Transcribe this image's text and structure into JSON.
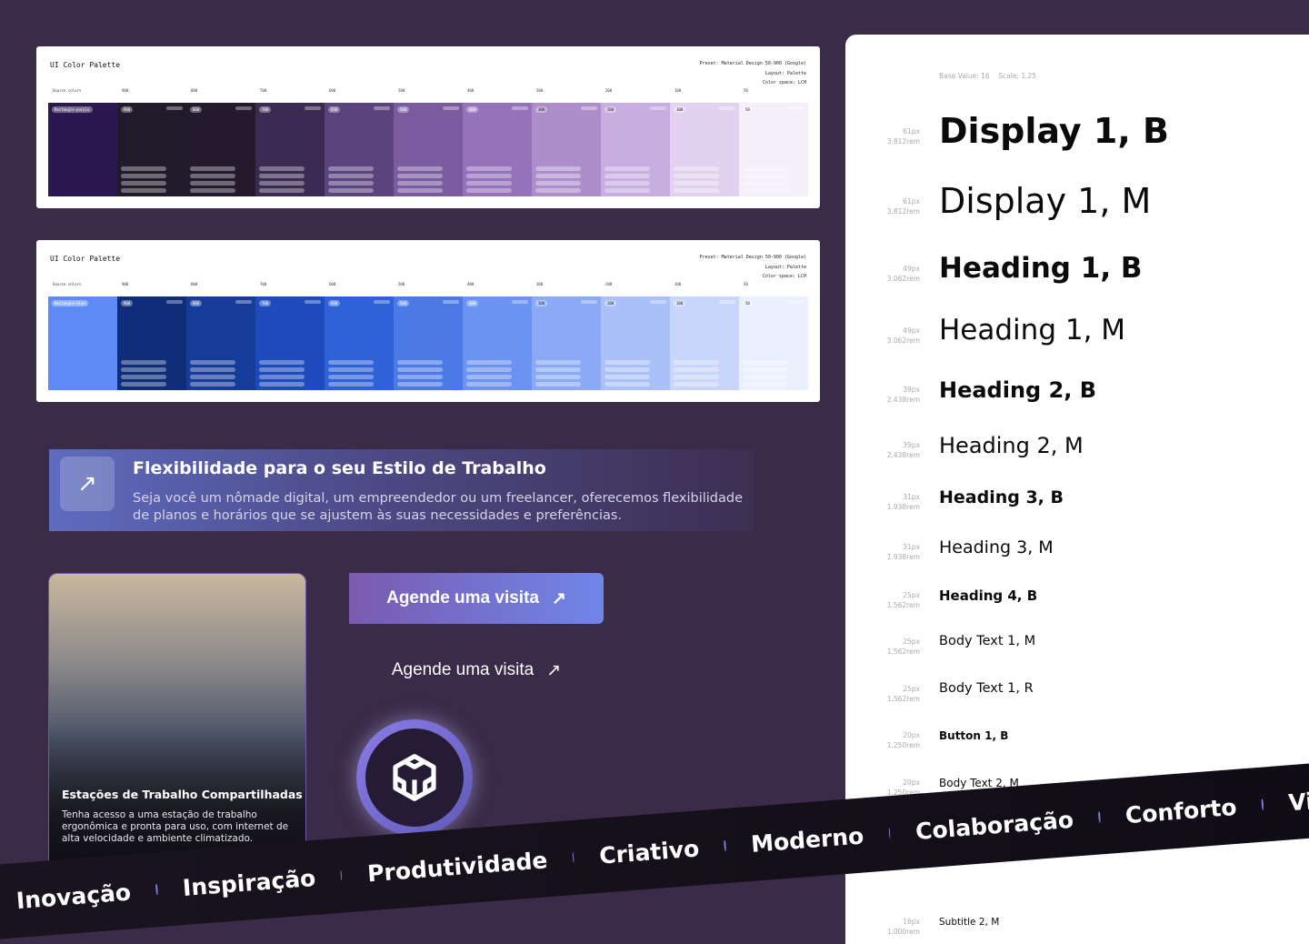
{
  "palettes": [
    {
      "title": "UI Color Palette",
      "preset": "Preset: Material Design 50-900 (Google)",
      "layout": "Layout: Palette",
      "colorspace": "Color space: LCH",
      "source_label": "Source colors",
      "source_name": "Rectangle-purple",
      "steps": [
        "900",
        "800",
        "700",
        "600",
        "500",
        "400",
        "300",
        "200",
        "100",
        "50"
      ],
      "colors": [
        "#2c1850",
        "#211a2a",
        "#231a2e",
        "#3b2a52",
        "#5b437e",
        "#7a5b9f",
        "#9672bb",
        "#ad8ecb",
        "#c8aee0",
        "#e2d2f0",
        "#f5eff9"
      ]
    },
    {
      "title": "UI Color Palette",
      "preset": "Preset: Material Design 50-900 (Google)",
      "layout": "Layout: Palette",
      "colorspace": "Color space: LCH",
      "source_label": "Source colors",
      "source_name": "Rectangle-blue",
      "steps": [
        "900",
        "800",
        "700",
        "600",
        "500",
        "400",
        "300",
        "200",
        "100",
        "50"
      ],
      "colors": [
        "#5e8bf7",
        "#0f2d78",
        "#163c9a",
        "#1e4cbc",
        "#2f62d8",
        "#4b7ae6",
        "#6a93f2",
        "#8ba9f5",
        "#a9c0f8",
        "#c9d6fb",
        "#ebf0fe"
      ]
    }
  ],
  "banner": {
    "title": "Flexibilidade para o seu Estilo de Trabalho",
    "text": "Seja você um nômade digital, um empreendedor ou um freelancer, oferecemos flexibilidade de planos e horários que se ajustem às suas necessidades e preferências.",
    "icon": "arrow-up-right"
  },
  "card": {
    "title": "Estações de Trabalho Compartilhadas",
    "text": "Tenha acesso a uma estação de trabalho ergonômica e pronta para uso, com internet de alta velocidade e ambiente climatizado."
  },
  "buttons": {
    "primary": "Agende uma visita",
    "secondary": "Agende uma visita",
    "arrow": "↗"
  },
  "typography": {
    "base": "Base Value: 16    Scale: 1.25",
    "rows": [
      {
        "px": "61px",
        "rem": "3.812rem",
        "name": "Display 1, B"
      },
      {
        "px": "61px",
        "rem": "3.812rem",
        "name": "Display 1, M"
      },
      {
        "px": "49px",
        "rem": "3.062rem",
        "name": "Heading 1, B"
      },
      {
        "px": "49px",
        "rem": "3.062rem",
        "name": "Heading 1, M"
      },
      {
        "px": "39px",
        "rem": "2.438rem",
        "name": "Heading 2, B"
      },
      {
        "px": "39px",
        "rem": "2.438rem",
        "name": "Heading 2, M"
      },
      {
        "px": "31px",
        "rem": "1.938rem",
        "name": "Heading 3, B"
      },
      {
        "px": "31px",
        "rem": "1.938rem",
        "name": "Heading 3, M"
      },
      {
        "px": "25px",
        "rem": "1.562rem",
        "name": "Heading 4, B"
      },
      {
        "px": "25px",
        "rem": "1.562rem",
        "name": "Body Text 1, M"
      },
      {
        "px": "25px",
        "rem": "1.562rem",
        "name": "Body Text 1, R"
      },
      {
        "px": "20px",
        "rem": "1.250rem",
        "name": "Button 1, B"
      },
      {
        "px": "20px",
        "rem": "1.250rem",
        "name": "Body Text 2, M"
      },
      {
        "px": "16px",
        "rem": "1.000rem",
        "name": "Subtitle 2, M"
      }
    ]
  },
  "ribbon": [
    "Inovação",
    "Inspiração",
    "Produtividade",
    "Criativo",
    "Moderno",
    "Colaboração",
    "Conforto",
    "Vibrante"
  ]
}
